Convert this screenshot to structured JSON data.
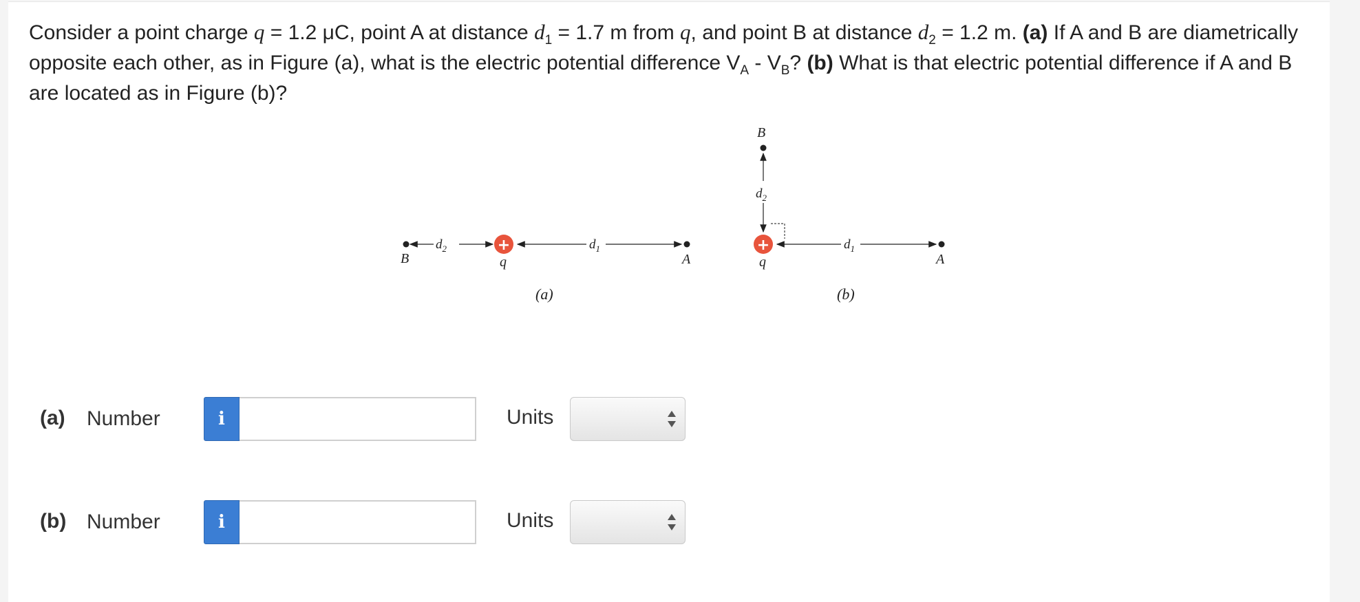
{
  "question": {
    "t1": "Consider a point charge ",
    "q_sym": "q",
    "t2": " = 1.2 μC, point A at distance ",
    "d_sym1": "d",
    "sub1": "1",
    "t3": " = 1.7 m from ",
    "q_sym2": "q",
    "t4": ", and point B at distance ",
    "d_sym2": "d",
    "sub2": "2",
    "t5": " = 1.2 m. ",
    "part_a_tag": "(a)",
    "t6": " If A and B are diametrically opposite each other, as in Figure (a), what is the electric potential difference V",
    "sub_a": "A",
    "t7": " - V",
    "sub_b": "B",
    "t8": "? ",
    "part_b_tag": "(b)",
    "t9": " What is that electric potential difference if A and B are located as in Figure (b)?"
  },
  "figure": {
    "fig_a": {
      "label_B": "B",
      "label_d2": "d",
      "label_d2_sub": "2",
      "charge_sign": "+",
      "label_q": "q",
      "label_d1": "d",
      "label_d1_sub": "1",
      "label_A": "A",
      "caption": "(a)"
    },
    "fig_b": {
      "label_B": "B",
      "label_d2": "d",
      "label_d2_sub": "2",
      "charge_sign": "+",
      "label_q": "q",
      "label_d1": "d",
      "label_d1_sub": "1",
      "label_A": "A",
      "caption": "(b)"
    },
    "colors": {
      "charge": "#e8543c",
      "ink": "#222222"
    }
  },
  "answers": [
    {
      "part": "(a)",
      "number_label": "Number",
      "info_icon": "i",
      "value": "",
      "units_label": "Units",
      "units_value": ""
    },
    {
      "part": "(b)",
      "number_label": "Number",
      "info_icon": "i",
      "value": "",
      "units_label": "Units",
      "units_value": ""
    }
  ],
  "colors": {
    "info_button": "#3b7ed4",
    "page_bg": "#f4f4f4",
    "panel_bg": "#ffffff"
  }
}
